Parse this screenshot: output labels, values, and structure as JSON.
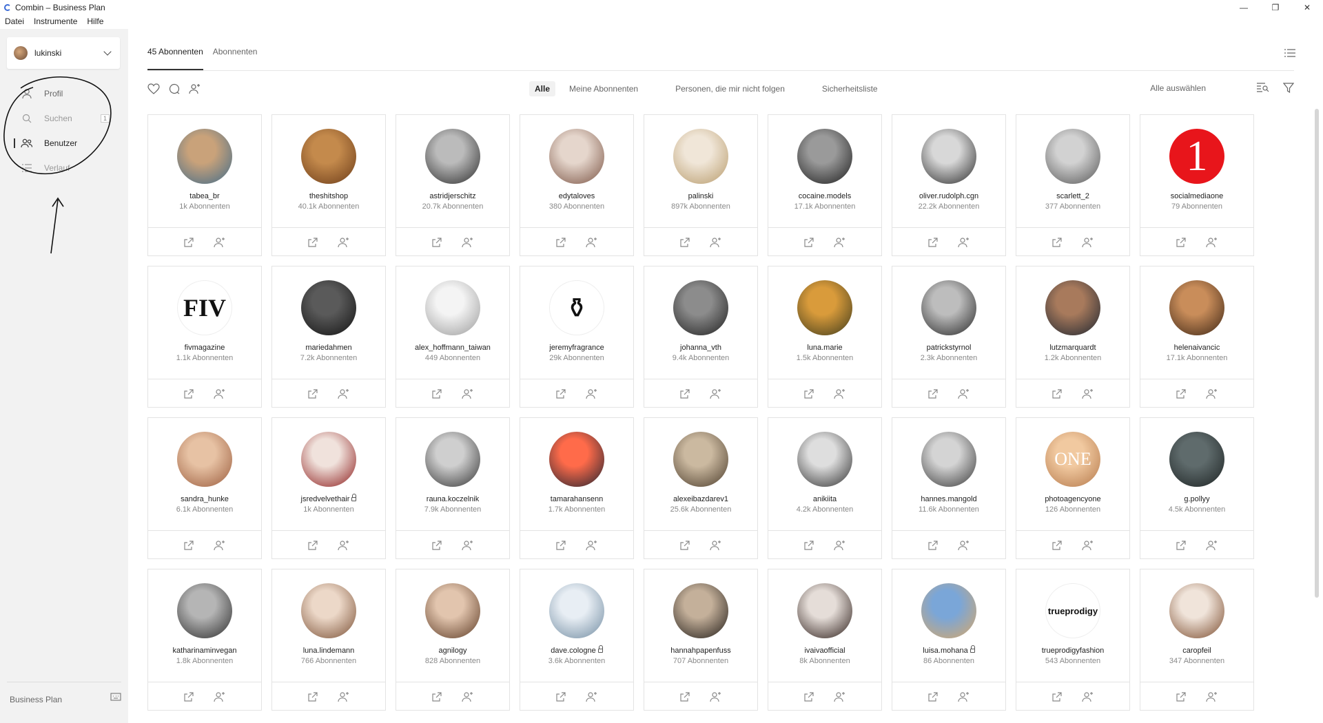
{
  "window": {
    "title": "Combin – Business Plan",
    "minimize": "—",
    "maximize": "❐",
    "close": "✕"
  },
  "menu": [
    "Datei",
    "Instrumente",
    "Hilfe"
  ],
  "sidebar": {
    "account": "lukinski",
    "items": [
      {
        "label": "Profil",
        "icon": "user-icon"
      },
      {
        "label": "Suchen",
        "icon": "search-icon",
        "badge": "1"
      },
      {
        "label": "Benutzer",
        "icon": "users-icon"
      },
      {
        "label": "Verlauf",
        "icon": "list-icon"
      }
    ],
    "plan": "Business Plan"
  },
  "tabs": [
    "45 Abonnenten",
    "Abonnenten"
  ],
  "filters": [
    "Alle",
    "Meine Abonnenten",
    "Personen, die mir nicht folgen",
    "Sicherheitsliste"
  ],
  "select_all": "Alle auswählen",
  "colors": {
    "accent": "#333333",
    "sidebar": "#f2f2f2",
    "card_border": "#e3e3e3",
    "annotation": "#111111"
  },
  "users": [
    {
      "name": "tabea_br",
      "followers": "1k Abonnenten",
      "locked": false,
      "c1": "#c9a27a",
      "c2": "#3f6b8a"
    },
    {
      "name": "theshitshop",
      "followers": "40.1k Abonnenten",
      "locked": false,
      "c1": "#c48a4c",
      "c2": "#6b3b18"
    },
    {
      "name": "astridjerschitz",
      "followers": "20.7k Abonnenten",
      "locked": false,
      "c1": "#bbbbbb",
      "c2": "#2b2b2b"
    },
    {
      "name": "edytaloves",
      "followers": "380 Abonnenten",
      "locked": false,
      "c1": "#e5d6cc",
      "c2": "#7a5343"
    },
    {
      "name": "palinski",
      "followers": "897k Abonnenten",
      "locked": false,
      "c1": "#f0e6d8",
      "c2": "#b79a6a"
    },
    {
      "name": "cocaine.models",
      "followers": "17.1k Abonnenten",
      "locked": false,
      "c1": "#9a9a9a",
      "c2": "#1c1c1c"
    },
    {
      "name": "oliver.rudolph.cgn",
      "followers": "22.2k Abonnenten",
      "locked": false,
      "c1": "#d8d8d8",
      "c2": "#2a2a2a"
    },
    {
      "name": "scarlett_2",
      "followers": "377 Abonnenten",
      "locked": false,
      "c1": "#d2d2d2",
      "c2": "#555555"
    },
    {
      "name": "socialmediaone",
      "followers": "79 Abonnenten",
      "locked": false,
      "c1": "#e8151b",
      "c2": "#e8151b",
      "glyph": "1"
    },
    {
      "name": "fivmagazine",
      "followers": "1.1k Abonnenten",
      "locked": false,
      "c1": "#ffffff",
      "c2": "#ffffff",
      "glyph": "FIV"
    },
    {
      "name": "mariedahmen",
      "followers": "7.2k Abonnenten",
      "locked": false,
      "c1": "#5a5a5a",
      "c2": "#111111"
    },
    {
      "name": "alex_hoffmann_taiwan",
      "followers": "449 Abonnenten",
      "locked": false,
      "c1": "#f4f4f4",
      "c2": "#9a9a9a"
    },
    {
      "name": "jeremyfragrance",
      "followers": "29k Abonnenten",
      "locked": false,
      "c1": "#ffffff",
      "c2": "#ffffff",
      "glyph": "⚱"
    },
    {
      "name": "johanna_vth",
      "followers": "9.4k Abonnenten",
      "locked": false,
      "c1": "#8c8c8c",
      "c2": "#1e1e1e"
    },
    {
      "name": "luna.marie",
      "followers": "1.5k Abonnenten",
      "locked": false,
      "c1": "#d99b3b",
      "c2": "#3d3a1c"
    },
    {
      "name": "patrickstyrnol",
      "followers": "2.3k Abonnenten",
      "locked": false,
      "c1": "#bdbdbd",
      "c2": "#262626"
    },
    {
      "name": "lutzmarquardt",
      "followers": "1.2k Abonnenten",
      "locked": false,
      "c1": "#a87a5c",
      "c2": "#1b2430"
    },
    {
      "name": "helenaivancic",
      "followers": "17.1k Abonnenten",
      "locked": false,
      "c1": "#c98d5a",
      "c2": "#3b2414"
    },
    {
      "name": "sandra_hunke",
      "followers": "6.1k Abonnenten",
      "locked": false,
      "c1": "#e7c2a4",
      "c2": "#9a5b3c"
    },
    {
      "name": "jsredvelvethair",
      "followers": "1k Abonnenten",
      "locked": true,
      "c1": "#f0e2dc",
      "c2": "#8c1b1b"
    },
    {
      "name": "rauna.koczelnik",
      "followers": "7.9k Abonnenten",
      "locked": false,
      "c1": "#cfcfcf",
      "c2": "#333333"
    },
    {
      "name": "tamarahansenn",
      "followers": "1.7k Abonnenten",
      "locked": false,
      "c1": "#ff6b4a",
      "c2": "#1e2230"
    },
    {
      "name": "alexeibazdarev1",
      "followers": "25.6k Abonnenten",
      "locked": false,
      "c1": "#cbb9a0",
      "c2": "#4a3b2a"
    },
    {
      "name": "anikiita",
      "followers": "4.2k Abonnenten",
      "locked": false,
      "c1": "#dedede",
      "c2": "#2f2f2f"
    },
    {
      "name": "hannes.mangold",
      "followers": "11.6k Abonnenten",
      "locked": false,
      "c1": "#d4d4d4",
      "c2": "#383838"
    },
    {
      "name": "photoagencyone",
      "followers": "126 Abonnenten",
      "locked": false,
      "c1": "#f1c9a0",
      "c2": "#b4784a",
      "glyph": "ONE"
    },
    {
      "name": "g.pollyy",
      "followers": "4.5k Abonnenten",
      "locked": false,
      "c1": "#5f6b6c",
      "c2": "#1c2222"
    },
    {
      "name": "katharinaminvegan",
      "followers": "1.8k Abonnenten",
      "locked": false,
      "c1": "#b5b5b5",
      "c2": "#2b2b2b"
    },
    {
      "name": "luna.lindemann",
      "followers": "766 Abonnenten",
      "locked": false,
      "c1": "#ecd8c8",
      "c2": "#7a4f34"
    },
    {
      "name": "agnilogy",
      "followers": "828 Abonnenten",
      "locked": false,
      "c1": "#e2c5ae",
      "c2": "#5c3a24"
    },
    {
      "name": "dave.cologne",
      "followers": "3.6k Abonnenten",
      "locked": true,
      "c1": "#e8eef4",
      "c2": "#6f8aa0"
    },
    {
      "name": "hannahpapenfuss",
      "followers": "707 Abonnenten",
      "locked": false,
      "c1": "#c4b09a",
      "c2": "#1f1a16"
    },
    {
      "name": "ivaivaofficial",
      "followers": "8k Abonnenten",
      "locked": false,
      "c1": "#e5ddd8",
      "c2": "#2b1c18"
    },
    {
      "name": "luisa.mohana",
      "followers": "86 Abonnenten",
      "locked": true,
      "c1": "#7aa6d8",
      "c2": "#d8a868"
    },
    {
      "name": "trueprodigyfashion",
      "followers": "543 Abonnenten",
      "locked": false,
      "c1": "#ffffff",
      "c2": "#ffffff",
      "glyph": "trueprodigy"
    },
    {
      "name": "caropfeil",
      "followers": "347 Abonnenten",
      "locked": false,
      "c1": "#f0e4da",
      "c2": "#7a4a2c"
    }
  ]
}
